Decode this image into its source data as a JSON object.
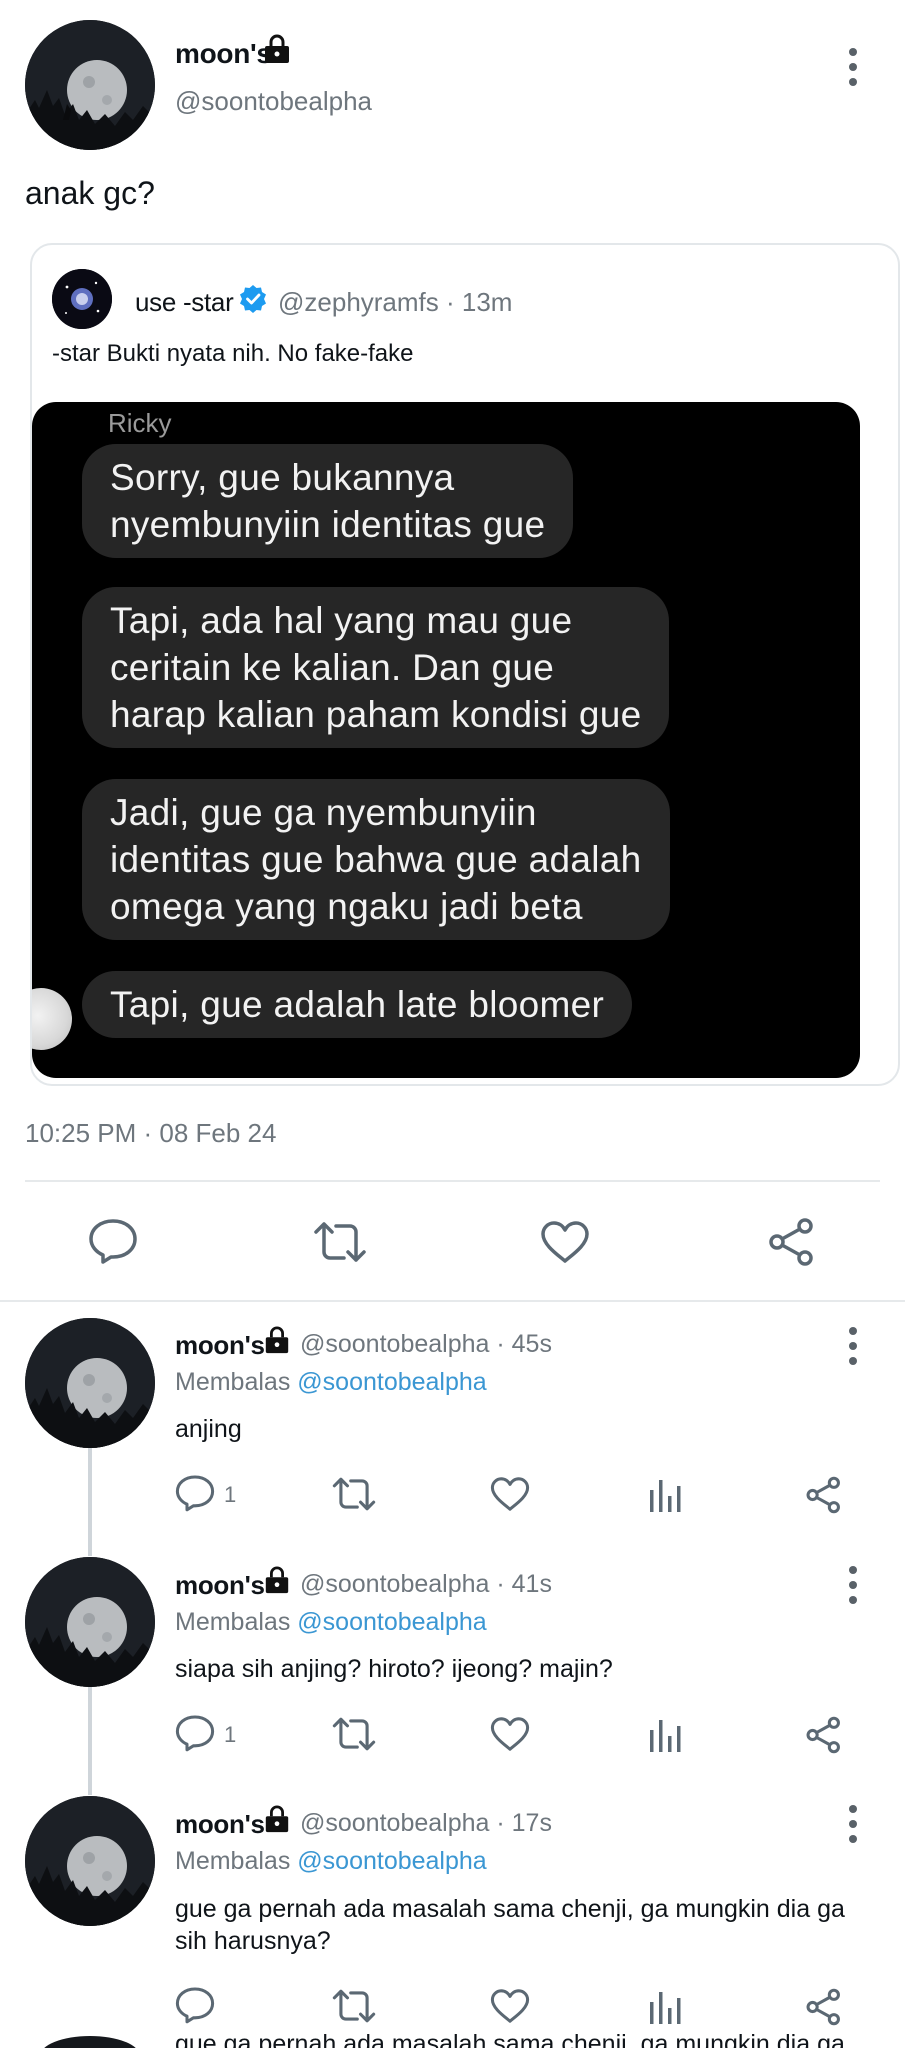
{
  "main_tweet": {
    "name": "moon's",
    "handle": "@soontobealpha",
    "text": "anak gc?",
    "timestamp": "10:25 PM · 08 Feb 24"
  },
  "quote": {
    "name": "use -star",
    "handle_time": "@zephyramfs · 13m",
    "text": "-star Bukti nyata nih. No fake-fake",
    "chat": {
      "sender": "Ricky",
      "bubbles": [
        "Sorry, gue bukannya\nnyembunyiin identitas gue",
        "Tapi, ada hal yang mau gue\nceritain ke kalian. Dan gue\nharap kalian paham kondisi gue",
        "Jadi, gue ga nyembunyiin\nidentitas gue bahwa gue adalah\nomega yang ngaku jadi beta",
        "Tapi, gue adalah late bloomer"
      ]
    }
  },
  "replies": [
    {
      "name": "moon's",
      "handle_time": "@soontobealpha · 45s",
      "replying_prefix": "Membalas",
      "replying_to": "@soontobealpha",
      "text": "anjing",
      "reply_count": "1"
    },
    {
      "name": "moon's",
      "handle_time": "@soontobealpha · 41s",
      "replying_prefix": "Membalas",
      "replying_to": "@soontobealpha",
      "text": "siapa sih anjing? hiroto? ijeong? majin?",
      "reply_count": "1"
    },
    {
      "name": "moon's",
      "handle_time": "@soontobealpha · 17s",
      "replying_prefix": "Membalas",
      "replying_to": "@soontobealpha",
      "text": "gue ga pernah ada masalah sama chenji, ga mungkin dia ga\nsih harusnya?",
      "reply_count": ""
    }
  ],
  "cut_off_text": "gue ga pernah ada masalah sama chenji, ga mungkin dia ga",
  "icons": {
    "lock": "lock-icon",
    "verified": "verified-badge-icon",
    "reply": "comment-icon",
    "retweet": "retweet-icon",
    "like": "heart-icon",
    "share": "share-icon",
    "analytics": "analytics-icon",
    "more": "more-vertical-icon"
  },
  "colors": {
    "link": "#3b97d3",
    "verified": "#1d9bf0",
    "muted": "#6e767d",
    "bubble": "#262626"
  }
}
